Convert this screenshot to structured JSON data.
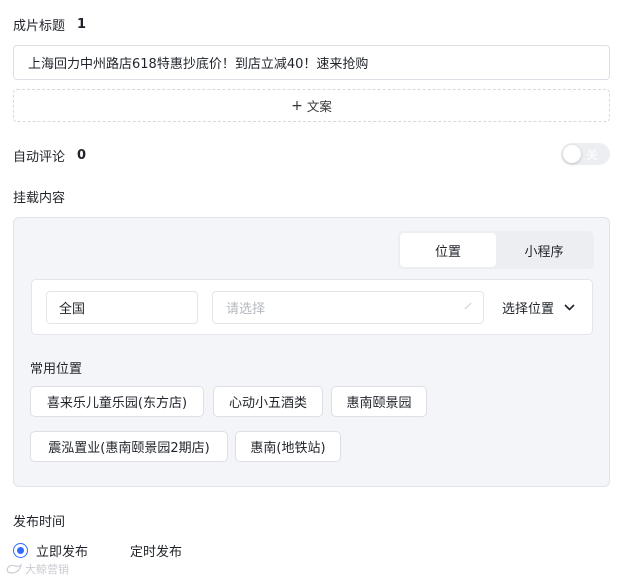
{
  "title_section": {
    "label": "成片标题",
    "count": "1",
    "value": "上海回力中州路店618特惠抄底价！到店立减40！速来抢购"
  },
  "add_copy": {
    "label": "文案"
  },
  "auto_comment": {
    "label": "自动评论",
    "count": "0",
    "toggle_text": "关",
    "toggle_on": false
  },
  "mount": {
    "label": "挂载内容",
    "tabs": [
      {
        "label": "位置",
        "active": true
      },
      {
        "label": "小程序",
        "active": false
      }
    ],
    "region_value": "全国",
    "place_placeholder": "请选择",
    "choose_location_label": "选择位置",
    "common_label": "常用位置",
    "common_locations": [
      "喜来乐儿童乐园(东方店)",
      "心动小五酒类",
      "惠南颐景园",
      "震泓置业(惠南颐景园2期店)",
      "惠南(地铁站)"
    ]
  },
  "publish": {
    "label": "发布时间",
    "options": [
      {
        "label": "立即发布",
        "checked": true
      },
      {
        "label": "定时发布",
        "checked": false
      }
    ]
  },
  "watermark": {
    "text": "大鲸营销"
  },
  "colors": {
    "accent": "#2f6bff",
    "panel_bg": "#f4f5f8",
    "border": "#dcdfe6",
    "text": "#1f2329",
    "placeholder": "#b5b9c0"
  }
}
